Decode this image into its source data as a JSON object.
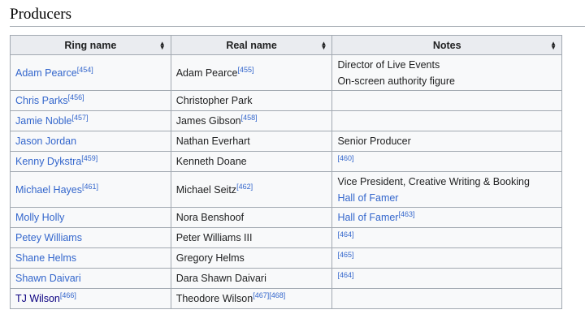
{
  "section": {
    "title": "Producers"
  },
  "table": {
    "headers": [
      "Ring name",
      "Real name",
      "Notes"
    ],
    "rows": [
      {
        "ring": "Adam Pearce",
        "ring_ref": "[454]",
        "real": "Adam Pearce",
        "real_ref": "[455]",
        "notes": [
          {
            "text": "Director of Live Events",
            "link": false
          },
          {
            "text": "On-screen authority figure",
            "link": false
          }
        ]
      },
      {
        "ring": "Chris Parks",
        "ring_ref": "[456]",
        "real": "Christopher Park",
        "real_ref": "",
        "notes": []
      },
      {
        "ring": "Jamie Noble",
        "ring_ref": "[457]",
        "real": "James Gibson",
        "real_ref": "[458]",
        "notes": []
      },
      {
        "ring": "Jason Jordan",
        "ring_ref": "",
        "real": "Nathan Everhart",
        "real_ref": "",
        "notes": [
          {
            "text": "Senior Producer",
            "link": false
          }
        ]
      },
      {
        "ring": "Kenny Dykstra",
        "ring_ref": "[459]",
        "real": "Kenneth Doane",
        "real_ref": "",
        "notes": [
          {
            "text": "",
            "ref": "[460]"
          }
        ]
      },
      {
        "ring": "Michael Hayes",
        "ring_ref": "[461]",
        "real": "Michael Seitz",
        "real_ref": "[462]",
        "notes": [
          {
            "text": "Vice President, Creative Writing & Booking",
            "link": false
          },
          {
            "text": "Hall of Famer",
            "link": true
          }
        ]
      },
      {
        "ring": "Molly Holly",
        "ring_ref": "",
        "real": "Nora Benshoof",
        "real_ref": "",
        "notes": [
          {
            "text": "Hall of Famer",
            "link": true,
            "ref": "[463]"
          }
        ]
      },
      {
        "ring": "Petey Williams",
        "ring_ref": "",
        "real": "Peter Williams III",
        "real_ref": "",
        "notes": [
          {
            "text": "",
            "ref": "[464]"
          }
        ]
      },
      {
        "ring": "Shane Helms",
        "ring_ref": "",
        "real": "Gregory Helms",
        "real_ref": "",
        "notes": [
          {
            "text": "",
            "ref": "[465]"
          }
        ]
      },
      {
        "ring": "Shawn Daivari",
        "ring_ref": "",
        "real": "Dara Shawn Daivari",
        "real_ref": "",
        "notes": [
          {
            "text": "",
            "ref": "[464]"
          }
        ]
      },
      {
        "ring": "TJ Wilson",
        "ring_ref": "[466]",
        "real": "Theodore Wilson",
        "real_ref": "[467][468]",
        "notes": [],
        "visited": true
      }
    ]
  }
}
